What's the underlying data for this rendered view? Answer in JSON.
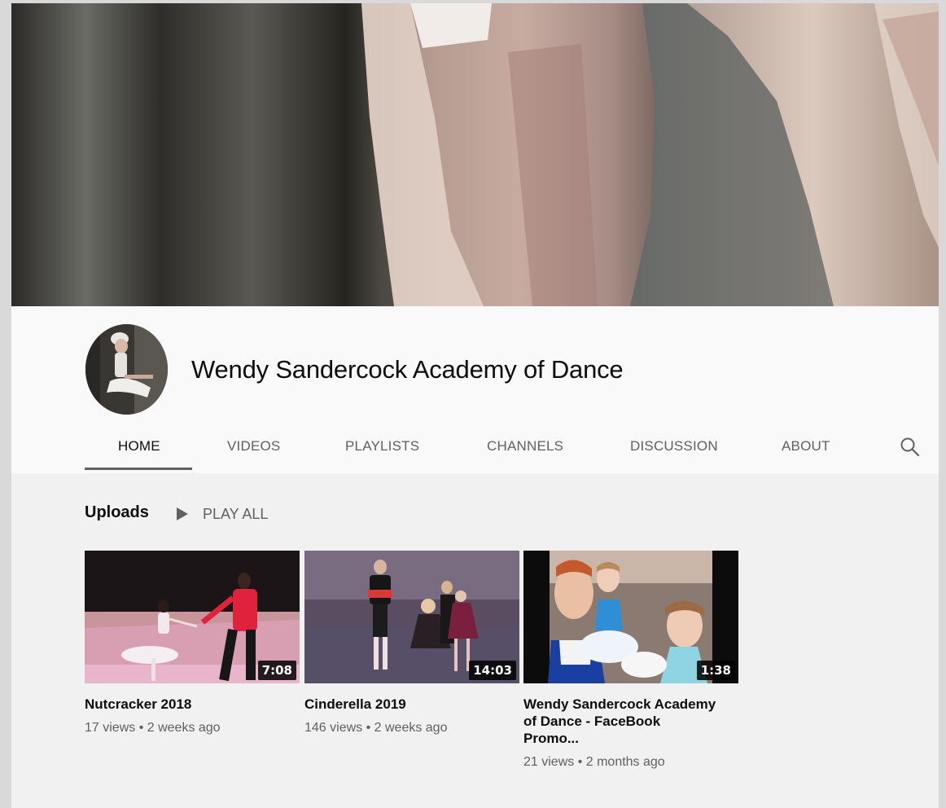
{
  "channel": {
    "name": "Wendy Sandercock Academy of Dance"
  },
  "tabs": [
    {
      "label": "HOME",
      "active": true
    },
    {
      "label": "VIDEOS",
      "active": false
    },
    {
      "label": "PLAYLISTS",
      "active": false
    },
    {
      "label": "CHANNELS",
      "active": false
    },
    {
      "label": "DISCUSSION",
      "active": false
    },
    {
      "label": "ABOUT",
      "active": false
    }
  ],
  "icons": {
    "search": "search-icon",
    "play": "play-icon"
  },
  "uploads": {
    "title": "Uploads",
    "play_all_label": "PLAY ALL",
    "videos": [
      {
        "title": "Nutcracker 2018",
        "meta": "17 views • 2 weeks ago",
        "duration": "7:08"
      },
      {
        "title": "Cinderella 2019",
        "meta": "146 views • 2 weeks ago",
        "duration": "14:03"
      },
      {
        "title": "Wendy Sandercock Academy of Dance - FaceBook Promo...",
        "meta": "21 views • 2 months ago",
        "duration": "1:38"
      }
    ]
  },
  "colors": {
    "page_bg": "#f1f1f1",
    "header_bg": "#f9f9f9",
    "text_primary": "#0d0d0d",
    "text_secondary": "#606060"
  }
}
